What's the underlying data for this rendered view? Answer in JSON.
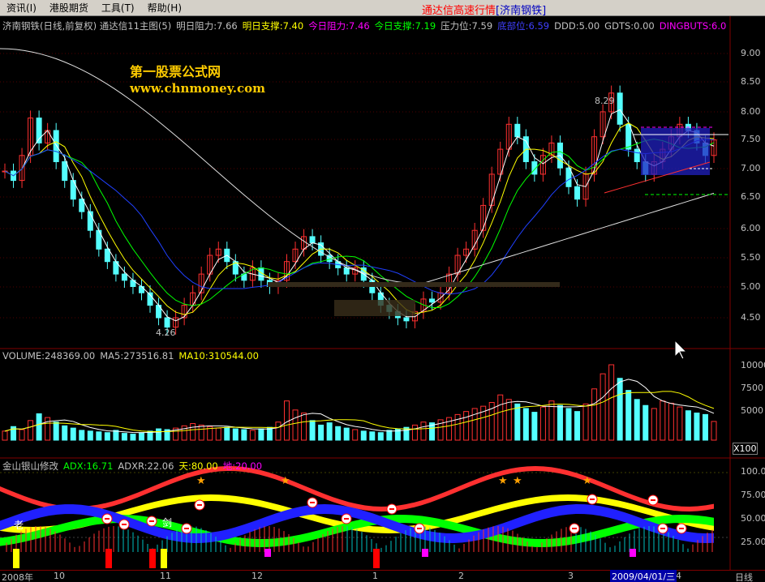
{
  "menu": [
    {
      "label": "资讯(I)",
      "name": "menu-info"
    },
    {
      "label": "港股期货",
      "name": "menu-hk-futures"
    },
    {
      "label": "工具(T)",
      "name": "menu-tools"
    },
    {
      "label": "帮助(H)",
      "name": "menu-help"
    }
  ],
  "app_title": "通达信高速行情",
  "app_stock": "[济南钢铁]",
  "main_panel": {
    "legend": [
      {
        "text": "济南钢铁(日线,前复权) 通达信11主图(5)",
        "color": "#c0c0c0"
      },
      {
        "text": "明日阻力:7.66",
        "color": "#c0c0c0"
      },
      {
        "text": "明日支撑:7.40",
        "color": "#ffff00"
      },
      {
        "text": "今日阻力:7.46",
        "color": "#ff00ff"
      },
      {
        "text": "今日支撑:7.19",
        "color": "#00ff00"
      },
      {
        "text": "压力位:7.59",
        "color": "#c0c0c0"
      },
      {
        "text": "底部位:6.59",
        "color": "#4040ff"
      },
      {
        "text": "DDD:5.00",
        "color": "#c0c0c0"
      },
      {
        "text": "GDTS:0.00",
        "color": "#c0c0c0"
      },
      {
        "text": "DINGBUTS:6.0",
        "color": "#ff00ff"
      }
    ],
    "y_ticks": [
      "9.00",
      "8.50",
      "8.00",
      "7.50",
      "7.00",
      "6.50",
      "6.00",
      "5.50",
      "5.00",
      "4.50"
    ],
    "annotations": {
      "high": "8.29",
      "low": "4.26"
    }
  },
  "watermark": {
    "line1": "第一股票公式网",
    "line2": "www.chnmoney.com"
  },
  "volume_panel": {
    "legend": [
      {
        "text": "VOLUME:248369.00",
        "color": "#c0c0c0"
      },
      {
        "text": "MA5:273516.81",
        "color": "#c0c0c0"
      },
      {
        "text": "MA10:310544.00",
        "color": "#ffff00"
      }
    ],
    "y_ticks": [
      "10000",
      "7500",
      "5000"
    ],
    "unit": "X100"
  },
  "indicator_panel": {
    "legend": [
      {
        "text": "金山银山修改",
        "color": "#c0c0c0"
      },
      {
        "text": "ADX:16.71",
        "color": "#00ff00"
      },
      {
        "text": "ADXR:22.06",
        "color": "#c0c0c0"
      },
      {
        "text": "天:80.00",
        "color": "#ffff00"
      },
      {
        "text": "地:20.00",
        "color": "#ff00ff"
      }
    ],
    "y_ticks": [
      "100.0",
      "75.00",
      "50.00",
      "25.00"
    ],
    "marks": {
      "old": "老",
      "jian": "剑"
    }
  },
  "date_axis": {
    "ticks": [
      "2008年",
      "10",
      "11",
      "12",
      "1",
      "2",
      "3",
      "4"
    ],
    "cursor_date": "2009/04/01/三",
    "period": "日线"
  },
  "colors": {
    "up": "#ff3030",
    "down": "#54ffff",
    "ma_white": "#ffffff",
    "ma_yellow": "#ffff00",
    "ma_green": "#00ff00",
    "ma_blue": "#2040ff"
  }
}
